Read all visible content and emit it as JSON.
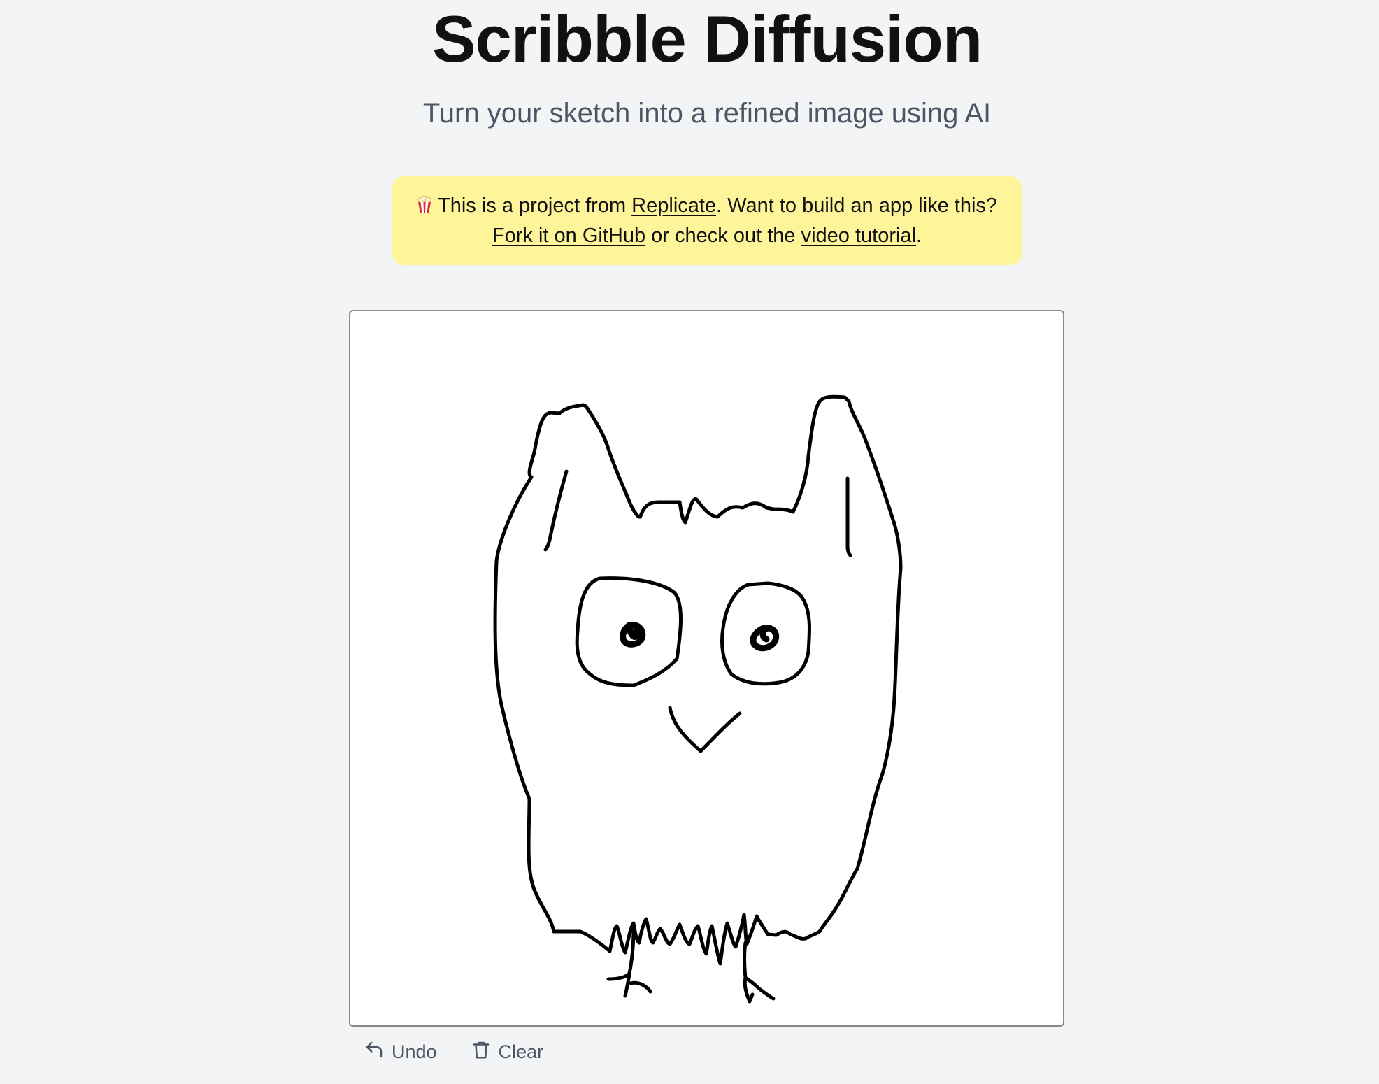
{
  "header": {
    "title": "Scribble Diffusion",
    "subtitle": "Turn your sketch into a refined image using AI"
  },
  "banner": {
    "icon": "popcorn-icon",
    "text_1": "This is a project from ",
    "link_replicate": "Replicate",
    "text_2": ". Want to build an app like this?",
    "link_github": "Fork it on GitHub",
    "text_3": " or check out the ",
    "link_tutorial": "video tutorial",
    "text_4": ".",
    "background_color": "#fef59a"
  },
  "canvas": {
    "drawing": "owl-sketch"
  },
  "toolbar": {
    "undo_label": "Undo",
    "undo_icon": "undo-icon",
    "clear_label": "Clear",
    "clear_icon": "trash-icon"
  }
}
